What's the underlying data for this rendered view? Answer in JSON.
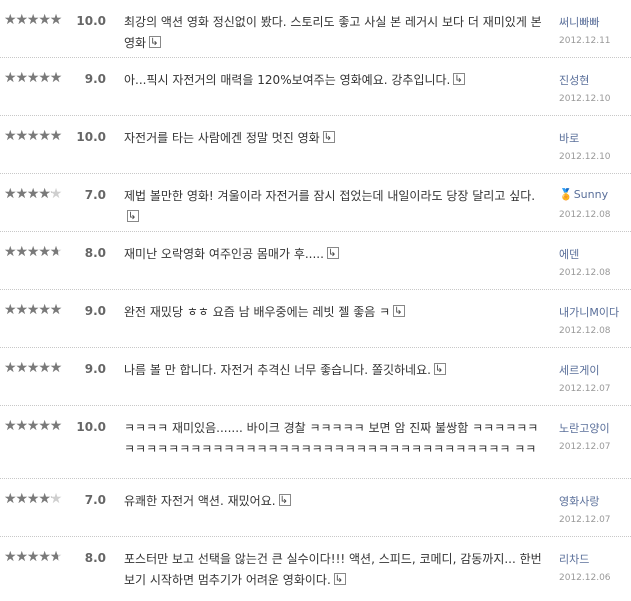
{
  "reviews": [
    {
      "score": "10.0",
      "rating": 10,
      "text": "최강의 액션 영화 정신없이 봤다. 스토리도 좋고 사실 본 레거시 보다 더 재미있게 본 영화",
      "user": "써니빠빠",
      "date": "2012.12.11",
      "medal": false
    },
    {
      "score": "9.0",
      "rating": 9,
      "text": "아...픽시 자전거의 매력을 120%보여주는 영화예요. 강추입니다.",
      "user": "진성현",
      "date": "2012.12.10",
      "medal": false
    },
    {
      "score": "10.0",
      "rating": 10,
      "text": "자전거를 타는 사람에겐 정말 멋진 영화",
      "user": "바로",
      "date": "2012.12.10",
      "medal": false
    },
    {
      "score": "7.0",
      "rating": 7,
      "text": "제법 볼만한 영화! 겨울이라 자전거를 잠시 접었는데 내일이라도 당장 달리고 싶다.",
      "user": "Sunny",
      "date": "2012.12.08",
      "medal": true
    },
    {
      "score": "8.0",
      "rating": 8,
      "text": "재미난 오락영화 여주인공 몸매가 후.....",
      "user": "에덴",
      "date": "2012.12.08",
      "medal": false
    },
    {
      "score": "9.0",
      "rating": 9,
      "text": "완전 재밌당 ㅎㅎ 요즘 남 배우중에는 레빗 젤 좋음 ㅋ",
      "user": "내가니M이다",
      "date": "2012.12.08",
      "medal": false
    },
    {
      "score": "9.0",
      "rating": 9,
      "text": "나름 볼 만 합니다. 자전거 추격신 너무 좋습니다. 쫄깃하네요.",
      "user": "세르게이",
      "date": "2012.12.07",
      "medal": false
    },
    {
      "score": "10.0",
      "rating": 10,
      "text": "ㅋㅋㅋㅋ 재미있음....... 바이크 경찰 ㅋㅋㅋㅋㅋ 보면 암 진짜 불쌍함 ㅋㅋㅋㅋㅋㅋㅋㅋㅋㅋㅋㅋㅋㅋㅋㅋㅋㅋㅋㅋㅋㅋㅋㅋㅋㅋㅋㅋㅋㅋㅋㅋㅋㅋㅋㅋㅋㅋㅋㅋㅋ ㅋㅋ",
      "user": "노란고양이",
      "date": "2012.12.07",
      "medal": false
    },
    {
      "score": "7.0",
      "rating": 7,
      "text": "유쾌한 자전거 액션. 재밌어요.",
      "user": "영화사랑",
      "date": "2012.12.07",
      "medal": false
    },
    {
      "score": "8.0",
      "rating": 8,
      "text": "포스터만 보고 선택을 않는건 큰 실수이다!!! 액션, 스피드, 코메디, 감동까지... 한번 보기 시작하면 멈추기가 어려운 영화이다.",
      "user": "리차드",
      "date": "2012.12.06",
      "medal": false
    }
  ],
  "icons": {
    "reply": "reply-arrow-icon",
    "star": "star-icon",
    "medal": "medal-icon"
  },
  "colors": {
    "star_filled": "#7a7a7a",
    "star_empty": "#cfcfcf",
    "user": "#5a6f9a",
    "date": "#999999"
  }
}
